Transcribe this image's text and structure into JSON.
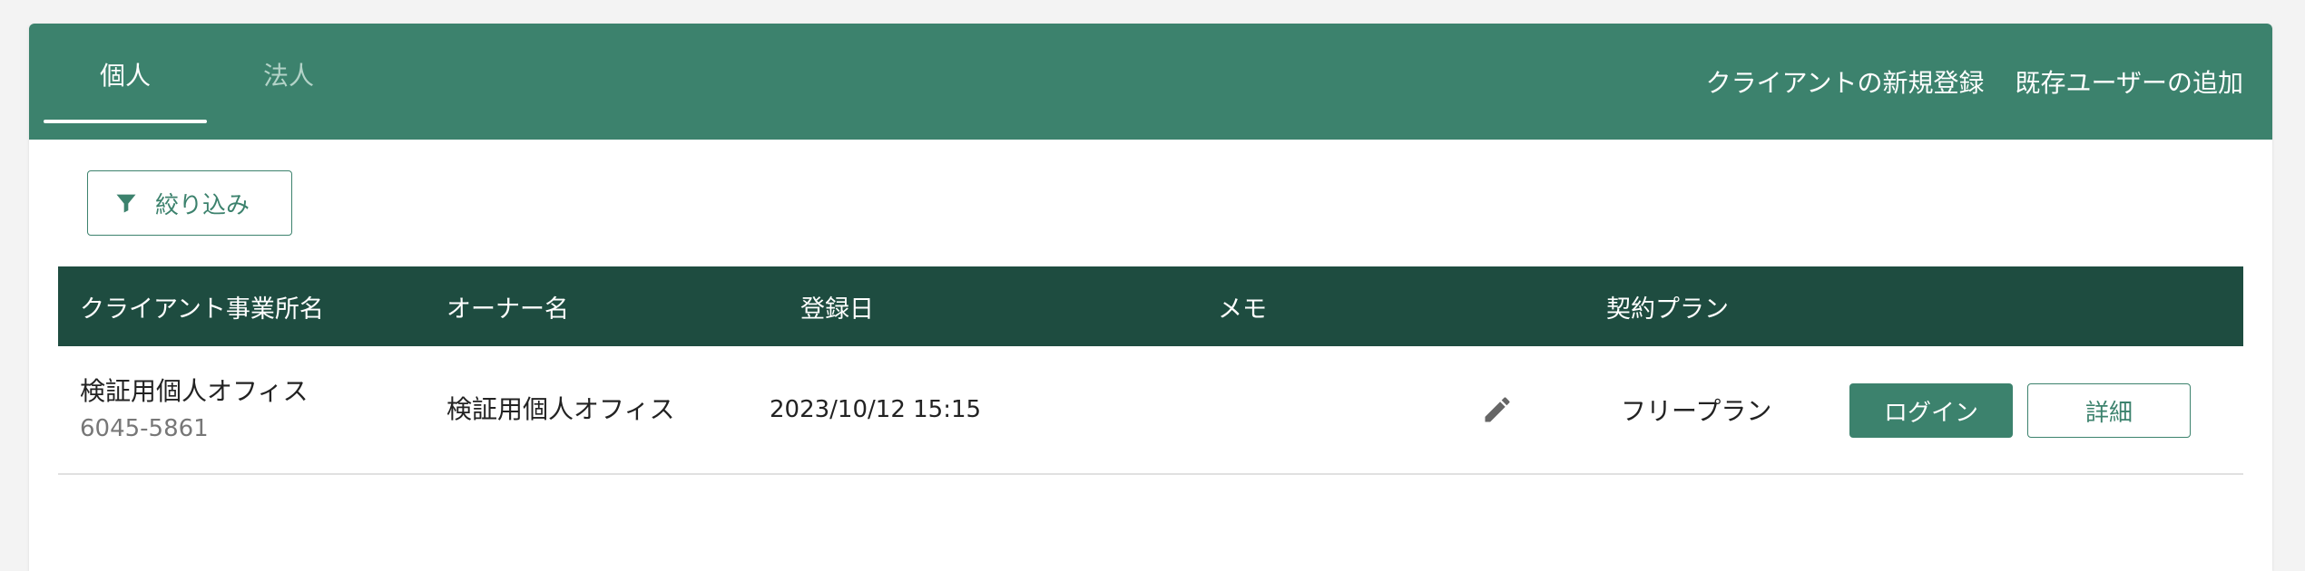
{
  "header": {
    "tabs": [
      {
        "label": "個人",
        "active": true
      },
      {
        "label": "法人",
        "active": false
      }
    ],
    "actions": {
      "new_client": "クライアントの新規登録",
      "add_user": "既存ユーザーの追加"
    }
  },
  "toolbar": {
    "filter_label": "絞り込み",
    "filter_icon": "filter-icon"
  },
  "table": {
    "columns": [
      "クライアント事業所名",
      "オーナー名",
      "登録日",
      "メモ",
      "契約プラン"
    ],
    "rows": [
      {
        "office_name": "検証用個人オフィス",
        "office_id": "6045-5861",
        "owner": "検証用個人オフィス",
        "registered": "2023/10/12 15:15",
        "memo_icon": "pencil-icon",
        "plan": "フリープラン",
        "login_label": "ログイン",
        "detail_label": "詳細"
      }
    ]
  },
  "colors": {
    "primary": "#3c826d",
    "header_dark": "#1e4c40",
    "background": "#f3f3f3"
  }
}
